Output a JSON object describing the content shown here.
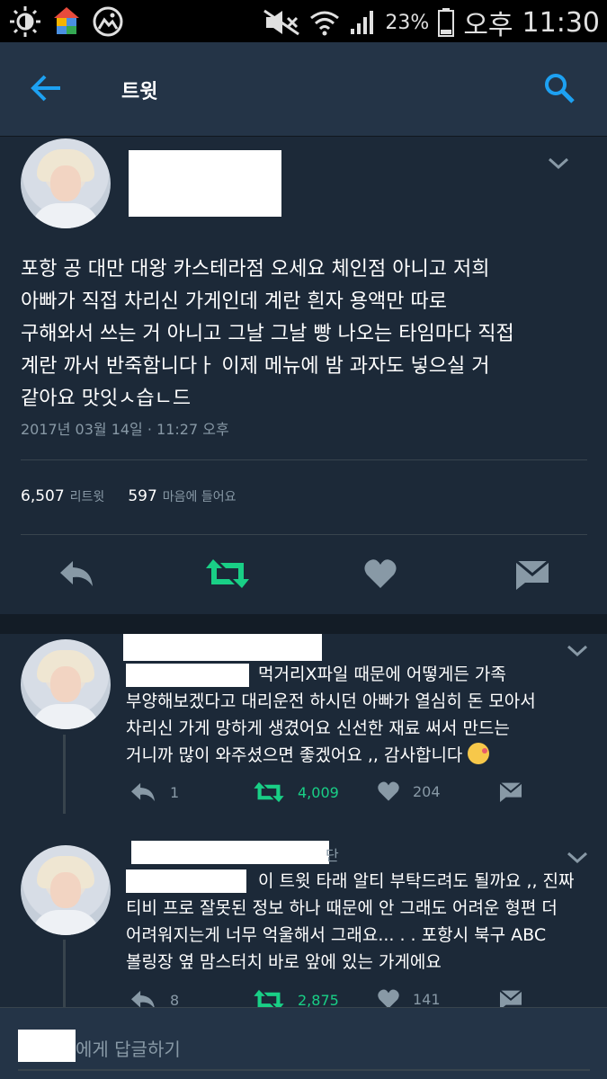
{
  "status_bar": {
    "battery": "23%",
    "ampm": "오후",
    "time": "11:30"
  },
  "header": {
    "title": "트윗"
  },
  "tweet": {
    "text": "포항 공 대만 대왕 카스테라점 오세요 체인점 아니고 저희\n아빠가 직접 차리신 가게인데 계란 흰자 용액만 따로\n구해와서 쓰는 거 아니고 그날 그날 빵 나오는 타임마다 직접\n계란 까서 반죽함니다ㅏ 이제 메뉴에 밤 과자도 넣으실 거\n같아요 맛잇ㅅ습ㄴ드",
    "timestamp": "2017년 03월 14일 · 11:27 오후",
    "retweets_count": "6,507",
    "retweets_label": "리트윗",
    "likes_count": "597",
    "likes_label": "마음에 들어요"
  },
  "replies": [
    {
      "text": "먹거리X파일 때문에 어떻게든 가족\n부양해보겠다고 대리운전 하시던 아빠가 열심히 돈 모아서\n차리신 가게 망하게 생겼어요 신선한 재료 써서 만드는\n거니까 많이 와주셨으면 좋겠어요 ,, 감사합니다",
      "reply_count": "1",
      "retweet_count": "4,009",
      "like_count": "204"
    },
    {
      "name_suffix": "단",
      "text": "이 트윗 타래 알티 부탁드려도 될까요 ,, 진짜\n티비 프로 잘못된 정보 하나 때문에 안 그래도 어려운 형편 더\n어려워지는게 너무 억울해서 그래요... . . 포항시 북구 ABC\n볼링장 옆 맘스터치 바로 앞에 있는 가게에요",
      "reply_count": "8",
      "retweet_count": "2,875",
      "like_count": "141"
    }
  ],
  "reply_bar": {
    "placeholder": "에게 답글하기"
  },
  "colors": {
    "background": "#1c2938",
    "header": "#243447",
    "accent": "#1da1f2",
    "retweet": "#19cf86",
    "muted": "#8899a6"
  },
  "icons": [
    "wifi-icon",
    "signal-icon",
    "battery-icon",
    "mute-icon",
    "back-arrow-icon",
    "search-icon",
    "chevron-down-icon",
    "reply-icon",
    "retweet-icon",
    "heart-icon",
    "message-icon"
  ]
}
